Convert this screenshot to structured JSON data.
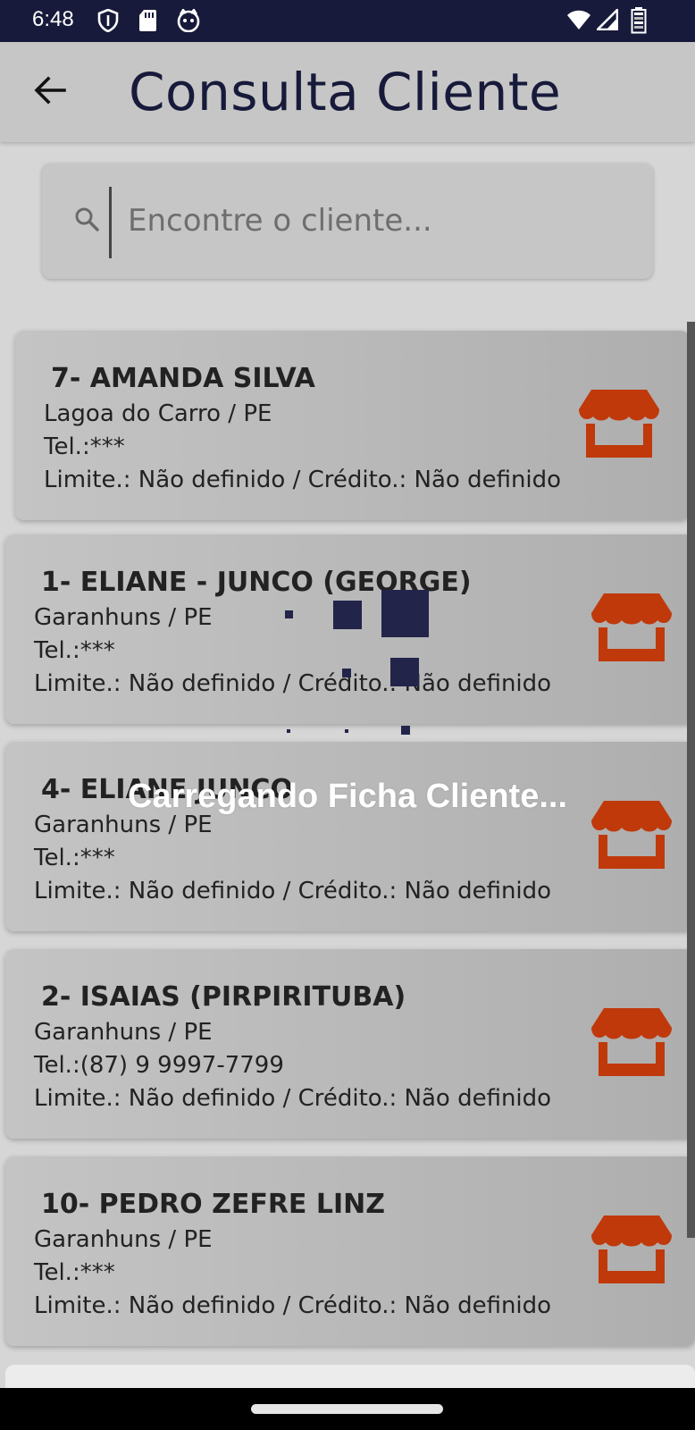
{
  "status_bar": {
    "time": "6:48",
    "left_icons": [
      "shield-icon",
      "sd-card-icon",
      "cat-icon"
    ],
    "right_icons": [
      "wifi-icon",
      "signal-icon",
      "battery-icon"
    ]
  },
  "app_bar": {
    "title": "Consulta Cliente",
    "back_icon": "arrow-left-icon"
  },
  "search": {
    "placeholder": "Encontre o cliente...",
    "value": "",
    "icon": "search-icon"
  },
  "clients": [
    {
      "name": "7- AMANDA SILVA",
      "city": "Lagoa do Carro / PE",
      "tel": "Tel.:***",
      "limit": "Limite.: Não definido",
      "credit": "Crédito.: Não definido",
      "icon": "store-icon"
    },
    {
      "name": "1- ELIANE - JUNCO (GEORGE)",
      "city": "Garanhuns / PE",
      "tel": "Tel.:***",
      "limit": "Limite.: Não definido",
      "credit": "Crédito.: Não definido",
      "icon": "store-icon"
    },
    {
      "name": "4- ELIANE JUNCO",
      "city": "Garanhuns / PE",
      "tel": "Tel.:***",
      "limit": "Limite.: Não definido",
      "credit": "Crédito.: Não definido",
      "icon": "store-icon"
    },
    {
      "name": "2- ISAIAS (PIRPIRITUBA)",
      "city": "Garanhuns / PE",
      "tel": "Tel.:(87) 9 9997-7799",
      "limit": "Limite.: Não definido",
      "credit": "Crédito.: Não definido",
      "icon": "store-icon"
    },
    {
      "name": "10- PEDRO ZEFRE LINZ",
      "city": "Garanhuns / PE",
      "tel": "Tel.:***",
      "limit": "Limite.: Não definido",
      "credit": "Crédito.: Não definido",
      "icon": "store-icon"
    }
  ],
  "separator": "/",
  "loading": {
    "text": "Carregando Ficha Cliente..."
  },
  "colors": {
    "primary_dark": "#171a3a",
    "store_icon": "#c0390b",
    "loader_squares": "#22244a"
  }
}
